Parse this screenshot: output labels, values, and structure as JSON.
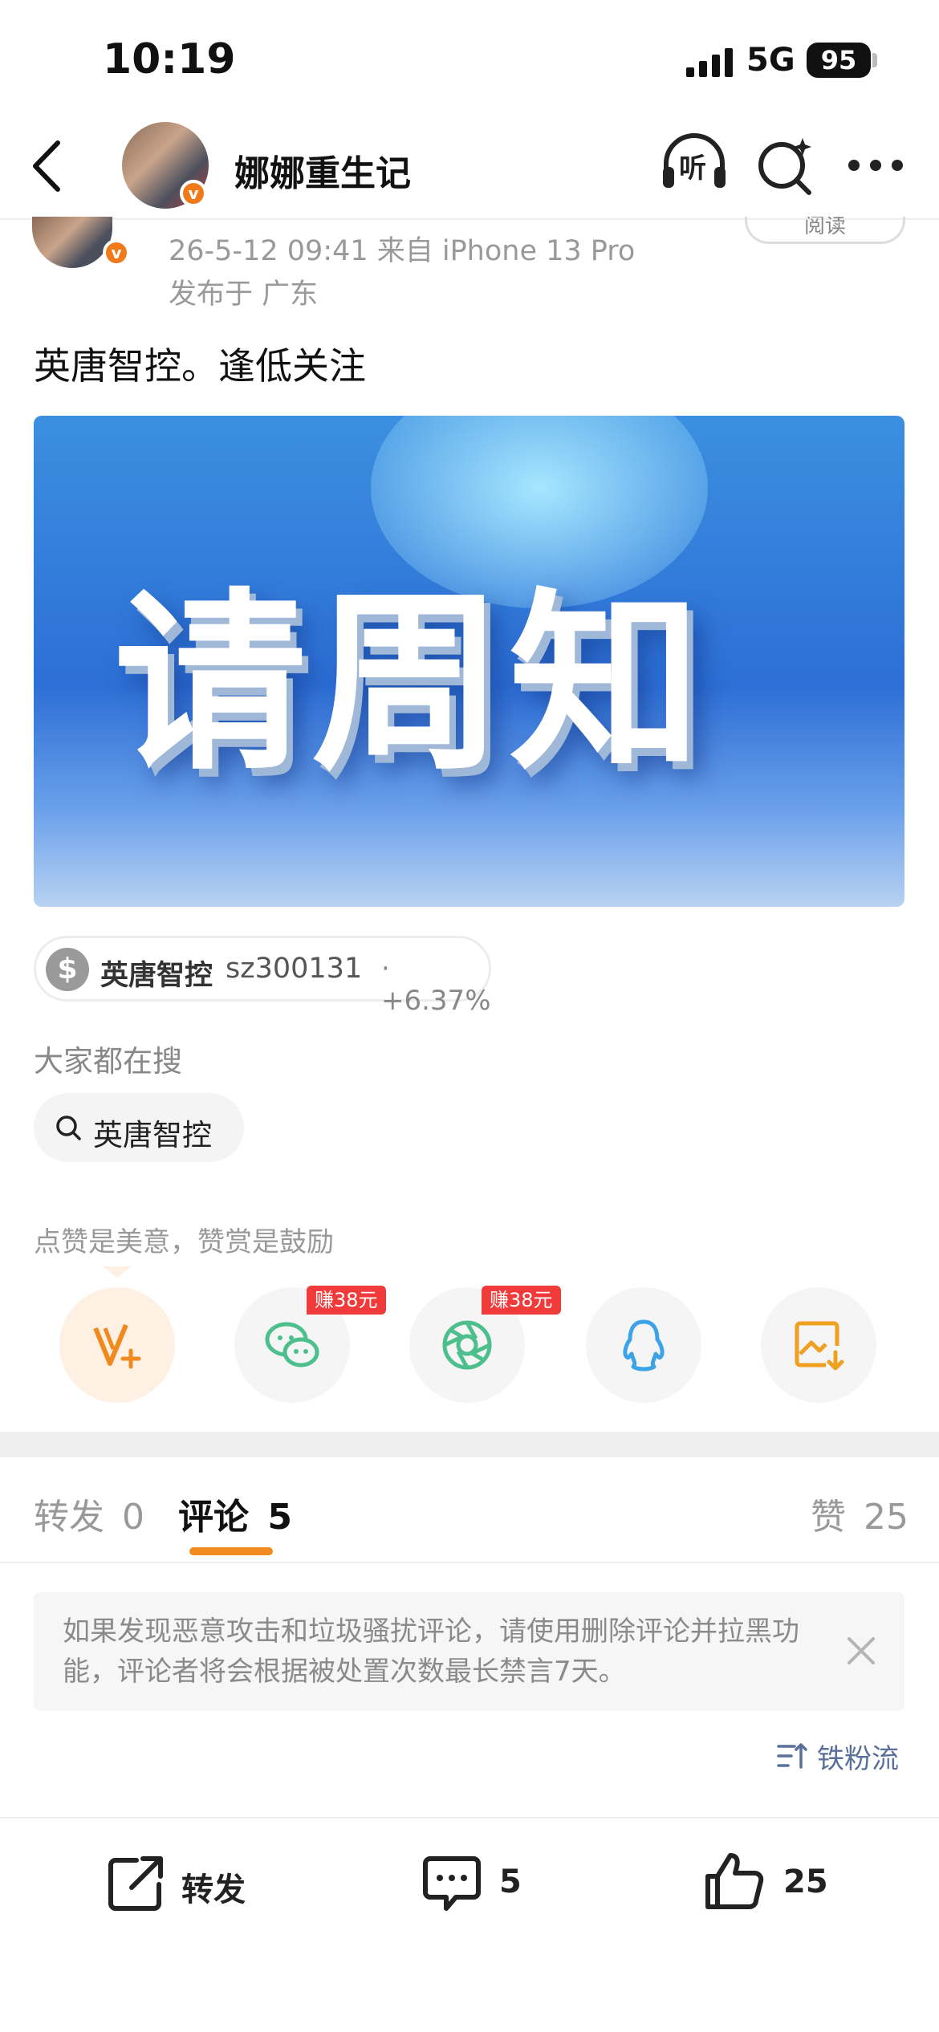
{
  "status_bar": {
    "time": "10:19",
    "network": "5G",
    "battery": "95"
  },
  "header": {
    "author_name": "娜娜重生记",
    "listen_label": "听"
  },
  "post": {
    "timestamp_source": "26-5-12 09:41  来自 iPhone 13 Pro",
    "location": "发布于 广东",
    "read_button": "阅读",
    "text": "英唐智控。逢低关注",
    "image_text": "请周知"
  },
  "stock": {
    "name": "英唐智控",
    "code": "sz300131",
    "change": "· +6.37%"
  },
  "search": {
    "title": "大家都在搜",
    "term": "英唐智控"
  },
  "reward": {
    "text": "点赞是美意，赞赏是鼓励"
  },
  "share": {
    "earn_badge_wechat": "赚38元",
    "earn_badge_moments": "赚38元"
  },
  "tabs": {
    "repost_label": "转发",
    "repost_count": "0",
    "comment_label": "评论",
    "comment_count": "5",
    "like_label": "赞",
    "like_count": "25"
  },
  "notice": {
    "text": "如果发现恶意攻击和垃圾骚扰评论，请使用删除评论并拉黑功能，评论者将会根据被处置次数最长禁言7天。"
  },
  "sort": {
    "label": "铁粉流"
  },
  "bottom_bar": {
    "repost_label": "转发",
    "comment_count": "5",
    "like_count": "25"
  },
  "colors": {
    "accent": "#f08a1e",
    "badge": "#f13a3a",
    "verified": "#f07a1a"
  }
}
